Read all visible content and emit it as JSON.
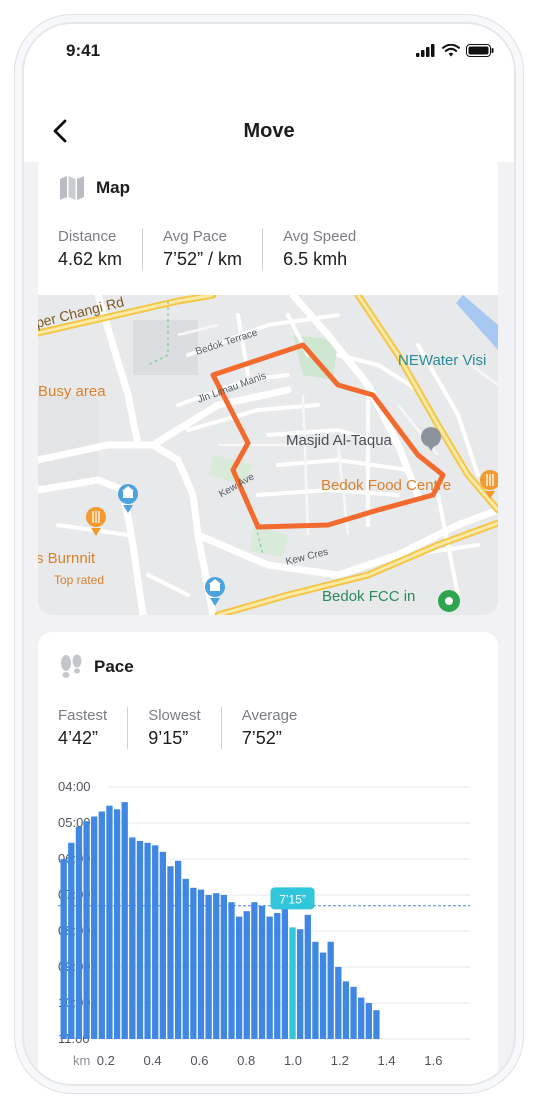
{
  "status": {
    "time": "9:41"
  },
  "header": {
    "title": "Move"
  },
  "map_card": {
    "title": "Map",
    "stats": [
      {
        "label": "Distance",
        "value": "4.62 km"
      },
      {
        "label": "Avg Pace",
        "value": "7’52” / km"
      },
      {
        "label": "Avg Speed",
        "value": "6.5 kmh"
      }
    ],
    "map_labels": {
      "changi": "per Changi Rd",
      "bedok_terrace": "Bedok Terrace",
      "jln_lmau_manis": "Jln Limau Manis",
      "newater": "NEWater Visi",
      "busy": "Busy area",
      "masjid": "Masjid Al-Taqua",
      "kew_ave": "Kew Ave",
      "food_centre": "Bedok Food Centre",
      "burnnit": "s Burnnit",
      "top_rated": "Top rated",
      "kew_cres": "Kew Cres",
      "fcc": "Bedok FCC in"
    },
    "route_color": "#f26a2e"
  },
  "pace_card": {
    "title": "Pace",
    "stats": [
      {
        "label": "Fastest",
        "value": "4’42”"
      },
      {
        "label": "Slowest",
        "value": "9’15”"
      },
      {
        "label": "Average",
        "value": "7’52”"
      }
    ]
  },
  "chart_data": {
    "type": "bar",
    "y_ticks": [
      "04:00",
      "05:00",
      "06:00",
      "07:00",
      "08:00",
      "09:00",
      "10:00",
      "11:00"
    ],
    "y_tick_minutes": [
      4,
      5,
      6,
      7,
      8,
      9,
      10,
      11
    ],
    "ylim": [
      4,
      11
    ],
    "y_inverted": true,
    "x_ticks": [
      "0.2",
      "0.4",
      "0.6",
      "0.8",
      "1.0",
      "1.2",
      "1.4",
      "1.6"
    ],
    "x_tick_values": [
      0.2,
      0.4,
      0.6,
      0.8,
      1.0,
      1.2,
      1.4,
      1.6
    ],
    "xlabel": "km",
    "x_start": 0.02,
    "x_step": 0.0326,
    "values": [
      6.0,
      5.55,
      5.1,
      4.95,
      4.82,
      4.68,
      4.52,
      4.62,
      4.42,
      5.4,
      5.5,
      5.55,
      5.62,
      5.8,
      6.2,
      6.05,
      6.55,
      6.8,
      6.85,
      7.0,
      6.95,
      7.0,
      7.2,
      7.6,
      7.45,
      7.2,
      7.3,
      7.6,
      7.5,
      7.35,
      7.9,
      7.95,
      7.55,
      8.3,
      8.6,
      8.3,
      9.0,
      9.4,
      9.55,
      9.85,
      10.0,
      10.2
    ],
    "highlight_index": 30,
    "highlight_label": "7’15”",
    "average_minutes": 7.3,
    "colors": {
      "bar": "#3f87e3",
      "highlight": "#31c6dc",
      "average_line": "#3f87e3",
      "grid": "#e6e7ea"
    }
  }
}
